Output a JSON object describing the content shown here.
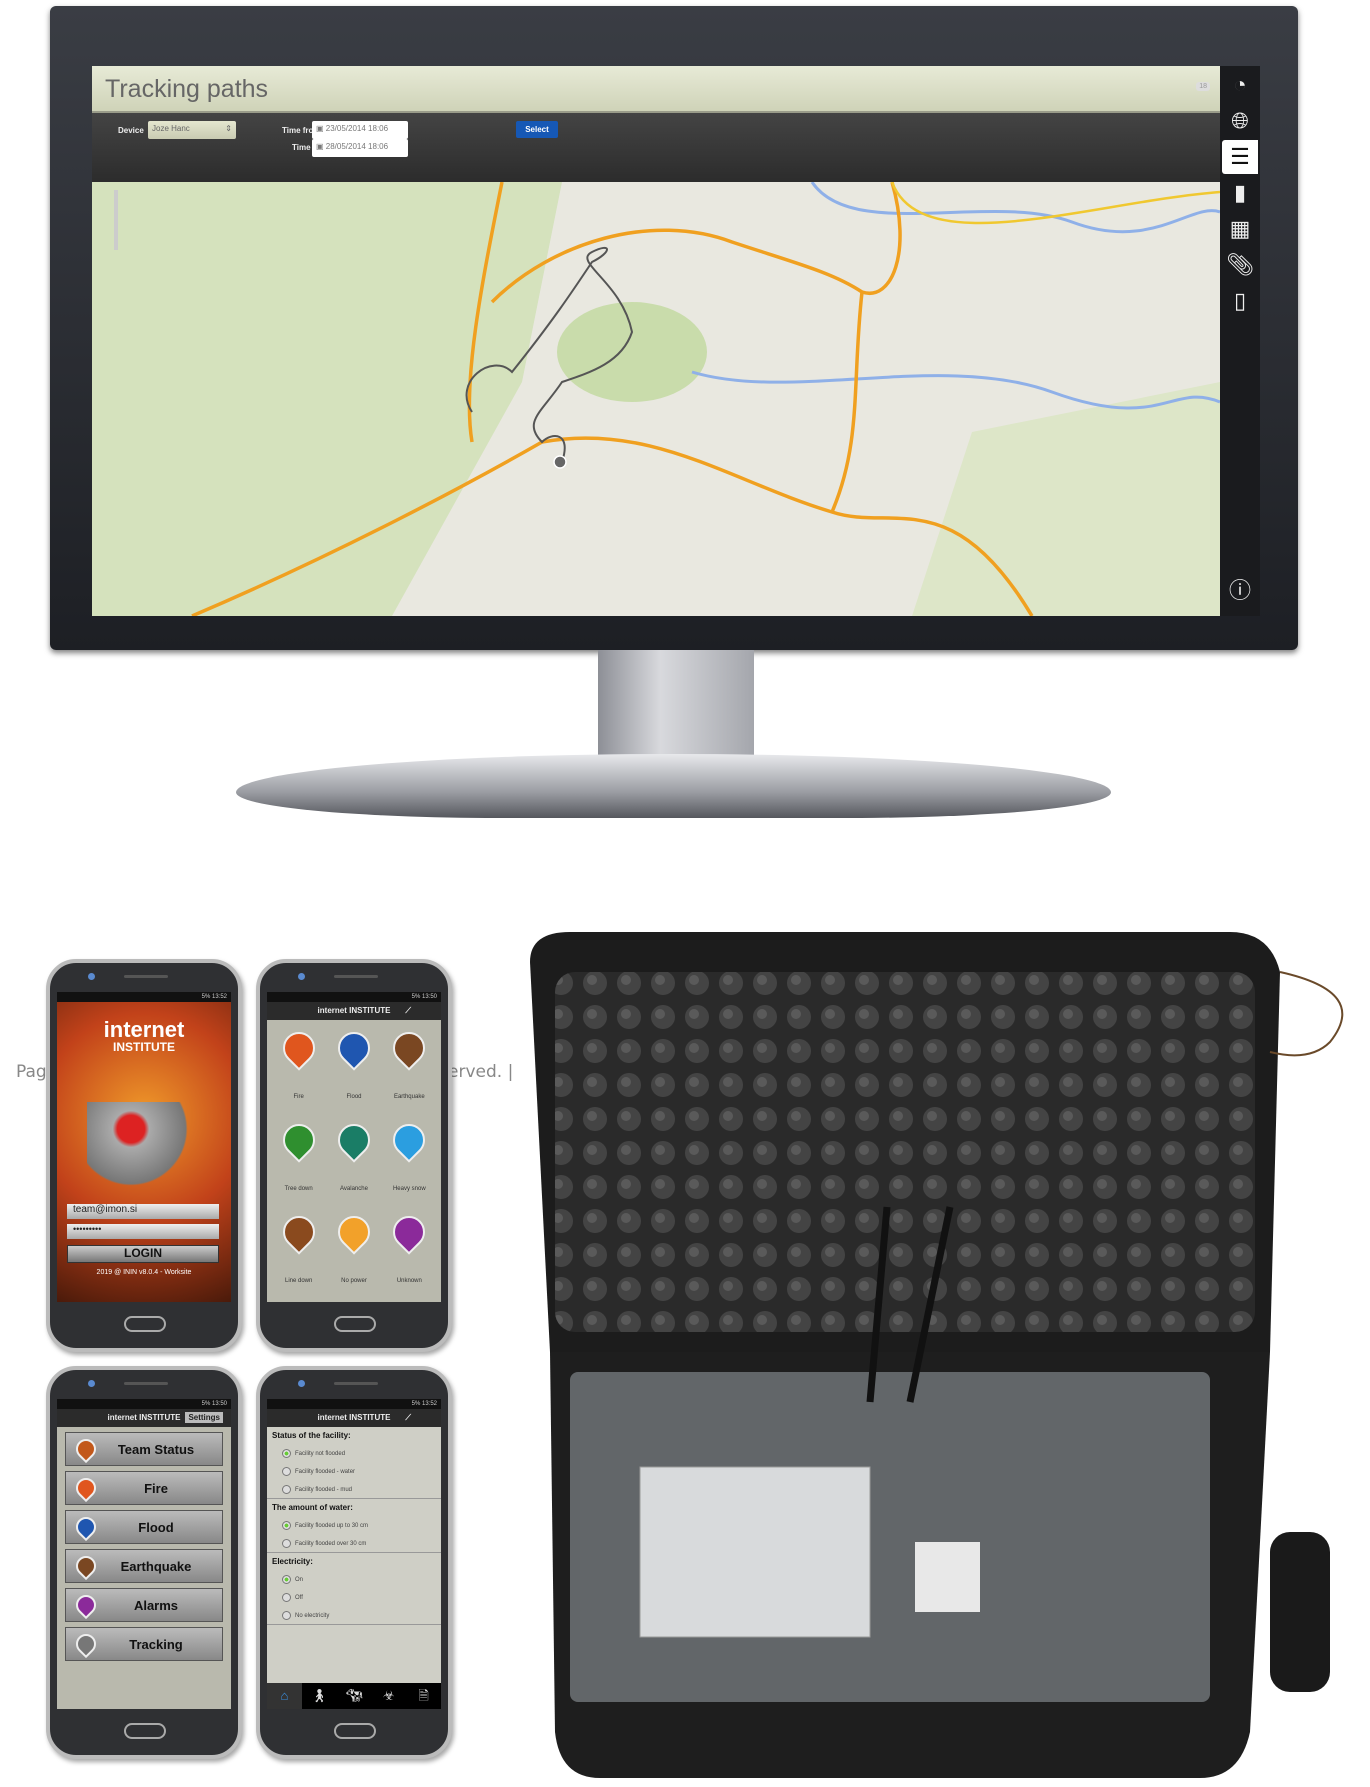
{
  "web_app": {
    "title": "Tracking paths",
    "header_badge": "18",
    "device_label": "Device",
    "device_value": "Joze Hanc",
    "time_from_label": "Time from",
    "time_from_value": "23/05/2014 18:06",
    "time_to_label": "Time to",
    "time_to_value": "28/05/2014 18:06",
    "select_button": "Select",
    "sidebar_icons": [
      "speedometer-icon",
      "globe-icon",
      "numbered-list-icon",
      "bar-chart-icon",
      "calendar-icon",
      "paperclip-icon",
      "tablet-icon",
      "info-icon"
    ],
    "active_sidebar_icon": "numbered-list-icon"
  },
  "background_text": {
    "left": "Pag",
    "right": "erved. |"
  },
  "phone_login": {
    "status": "5% 13:52",
    "logo_line1": "internet",
    "logo_line2": "INSTITUTE",
    "email": "team@imon.si",
    "password": "•••••••••",
    "login_button": "LOGIN",
    "footer": "2019 @ ININ v8.0.4 - Worksite"
  },
  "phone_alarms": {
    "status": "5% 13:50",
    "logo": "internet INSTITUTE",
    "items": [
      {
        "label": "Fire",
        "color": "#e0561e"
      },
      {
        "label": "Flood",
        "color": "#1f56b0"
      },
      {
        "label": "Earthquake",
        "color": "#7a4722"
      },
      {
        "label": "Tree down",
        "color": "#2f8f2f"
      },
      {
        "label": "Avalanche",
        "color": "#1a7d66"
      },
      {
        "label": "Heavy snow",
        "color": "#2b9ee0"
      },
      {
        "label": "Line down",
        "color": "#8a4a1e"
      },
      {
        "label": "No power",
        "color": "#f2a12a"
      },
      {
        "label": "Unknown",
        "color": "#8b2a9a"
      }
    ]
  },
  "phone_menu": {
    "status": "5% 13:50",
    "logo": "internet INSTITUTE",
    "settings_button": "Settings",
    "items": [
      {
        "label": "Team Status",
        "color": "#c2581a"
      },
      {
        "label": "Fire",
        "color": "#e0561e"
      },
      {
        "label": "Flood",
        "color": "#1f56b0"
      },
      {
        "label": "Earthquake",
        "color": "#7a4722"
      },
      {
        "label": "Alarms",
        "color": "#8b2a9a"
      },
      {
        "label": "Tracking",
        "color": "#777777"
      }
    ]
  },
  "phone_form": {
    "status": "5% 13:52",
    "logo": "internet INSTITUTE",
    "sections": [
      {
        "title": "Status of the facility:",
        "options": [
          {
            "label": "Facility not flooded",
            "selected": true
          },
          {
            "label": "Facility flooded - water",
            "selected": false
          },
          {
            "label": "Facility flooded - mud",
            "selected": false
          }
        ]
      },
      {
        "title": "The amount of water:",
        "options": [
          {
            "label": "Facility flooded up to 30 cm",
            "selected": true
          },
          {
            "label": "Facility flooded over 30 cm",
            "selected": false
          }
        ]
      },
      {
        "title": "Electricity:",
        "options": [
          {
            "label": "On",
            "selected": true
          },
          {
            "label": "Off",
            "selected": false
          },
          {
            "label": "No electricity",
            "selected": false
          }
        ]
      }
    ],
    "tabs": [
      "home-icon",
      "person-icon",
      "cow-icon",
      "biohazard-icon",
      "document-icon"
    ]
  }
}
